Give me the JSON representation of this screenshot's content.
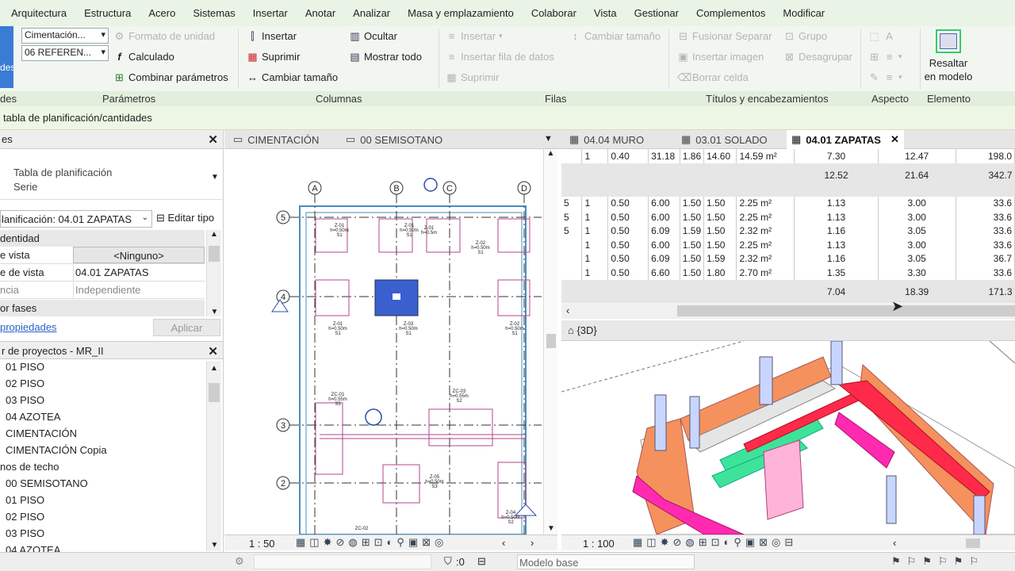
{
  "menu": [
    "Arquitectura",
    "Estructura",
    "Acero",
    "Sistemas",
    "Insertar",
    "Anotar",
    "Analizar",
    "Masa y emplazamiento",
    "Colaborar",
    "Vista",
    "Gestionar",
    "Complementos",
    "Modificar"
  ],
  "ribbon": {
    "left_btn": "des",
    "param": {
      "dd1": "Cimentación...",
      "dd2": "06 REFEREN...",
      "formato": "Formato de unidad",
      "calculado": "Calculado",
      "combinar": "Combinar parámetros"
    },
    "cols": {
      "insertar": "Insertar",
      "suprimir": "Suprimir",
      "cambiar": "Cambiar tamaño",
      "ocultar": "Ocultar",
      "mostrar": "Mostrar  todo"
    },
    "filas": {
      "insertar": "Insertar",
      "insertar_fila": "Insertar  fila de datos",
      "suprimir": "Suprimir",
      "cambiar": "Cambiar tamaño"
    },
    "titulos": {
      "fusionar": "Fusionar  Separar",
      "insertar_imagen": "Insertar  imagen",
      "borrar": "Borrar  celda",
      "grupo": "Grupo",
      "desagrupar": "Desagrupar"
    },
    "resaltar": "Resaltar en modelo",
    "labels": {
      "l0": "des",
      "param": "Parámetros",
      "cols": "Columnas",
      "filas": "Filas",
      "titulos": "Títulos y encabezamientos",
      "aspecto": "Aspecto",
      "elemento": "Elemento"
    }
  },
  "context_title": "tabla de planificación/cantidades",
  "properties": {
    "title": "es",
    "type_line1": "Tabla de planificación",
    "type_line2": "Serie",
    "selector": "lanificación: 04.01 ZAPATAS",
    "edit_type": "Editar tipo",
    "section_identity": "dentidad",
    "rows": [
      {
        "k": "e vista",
        "v": "<Ninguno>"
      },
      {
        "k": "e de vista",
        "v": "04.01 ZAPATAS"
      },
      {
        "k": "ncia",
        "v": "Independiente"
      }
    ],
    "section_phases": "or fases",
    "link": "propiedades",
    "apply": "Aplicar"
  },
  "browser": {
    "title": "r de proyectos - MR_II",
    "items": [
      "01 PISO",
      "02 PISO",
      "03 PISO",
      "04 AZOTEA",
      "CIMENTACIÓN",
      "CIMENTACIÓN Copia",
      "nos de techo",
      "00 SEMISOTANO",
      "01 PISO",
      "02 PISO",
      "03 PISO",
      "04 AZOTEA"
    ]
  },
  "tabs_left": [
    "CIMENTACIÓN",
    "00 SEMISOTANO"
  ],
  "tabs_right": [
    "04.04 MURO",
    "03.01 SOLADO",
    "04.01 ZAPATAS"
  ],
  "schedule": {
    "rows": [
      {
        "type": "data",
        "c": [
          "",
          "1",
          "0.40",
          "31.18",
          "1.86",
          "14.60",
          "14.59 m²",
          "7.30",
          "12.47",
          "198.0"
        ]
      },
      {
        "type": "total",
        "c": [
          "",
          "",
          "",
          "",
          "",
          "",
          "",
          "12.52",
          "21.64",
          "342.7"
        ]
      },
      {
        "type": "blank",
        "c": [
          "",
          "",
          "",
          "",
          "",
          "",
          "",
          "",
          "",
          ""
        ]
      },
      {
        "type": "data",
        "c": [
          "5",
          "1",
          "0.50",
          "6.00",
          "1.50",
          "1.50",
          "2.25 m²",
          "1.13",
          "3.00",
          "33.6"
        ]
      },
      {
        "type": "data",
        "c": [
          "5",
          "1",
          "0.50",
          "6.00",
          "1.50",
          "1.50",
          "2.25 m²",
          "1.13",
          "3.00",
          "33.6"
        ]
      },
      {
        "type": "data",
        "c": [
          "5",
          "1",
          "0.50",
          "6.09",
          "1.59",
          "1.50",
          "2.32 m²",
          "1.16",
          "3.05",
          "33.6"
        ]
      },
      {
        "type": "data",
        "c": [
          "",
          "1",
          "0.50",
          "6.00",
          "1.50",
          "1.50",
          "2.25 m²",
          "1.13",
          "3.00",
          "33.6"
        ]
      },
      {
        "type": "data",
        "c": [
          "",
          "1",
          "0.50",
          "6.09",
          "1.50",
          "1.59",
          "2.32 m²",
          "1.16",
          "3.05",
          "36.7"
        ]
      },
      {
        "type": "data",
        "c": [
          "",
          "1",
          "0.50",
          "6.60",
          "1.50",
          "1.80",
          "2.70 m²",
          "1.35",
          "3.30",
          "33.6"
        ]
      },
      {
        "type": "total",
        "c": [
          "",
          "",
          "",
          "",
          "",
          "",
          "",
          "7.04",
          "18.39",
          "171.3"
        ]
      }
    ]
  },
  "view3d_title": "{3D}",
  "plan": {
    "grid_cols": [
      "A",
      "B",
      "C",
      "D"
    ],
    "grid_rows": [
      "5",
      "4",
      "3",
      "2"
    ],
    "labels": [
      "Z-01",
      "h=0.50m",
      "S1",
      "Z-01",
      "h=0.50m",
      "S1",
      "Z-01",
      "h=0.5m",
      "Z-02",
      "h=0.50m",
      "S1",
      "Z-01",
      "h=0.50m",
      "S1",
      "Z-03",
      "h=0.50m",
      "S1",
      "Z-02",
      "h=0.50m",
      "S1",
      "ZC-01",
      "h=0.55m",
      "S3",
      "ZC-03",
      "h=0.55m",
      "S2",
      "Z-05",
      "h=0.50m",
      "S3",
      "ZC-02",
      "Z-04",
      "h=0.50m",
      "S2"
    ]
  },
  "scale_left": "1 : 50",
  "scale_right": "1 : 100",
  "status": {
    "count": ":0",
    "model": "Modelo base"
  },
  "colors": {
    "accent": "#3a7bd5",
    "menu_bg": "#e9f3e6",
    "ribbon_bg": "#f2f6f1"
  }
}
